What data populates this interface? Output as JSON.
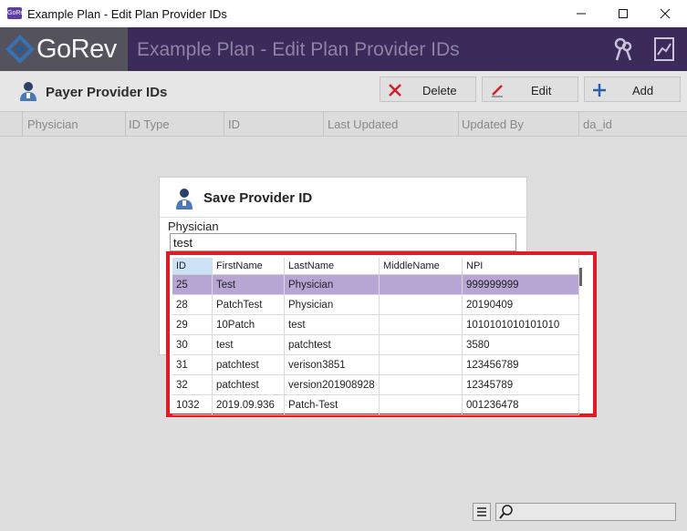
{
  "window": {
    "title": "Example Plan - Edit Plan Provider IDs",
    "icon_text": "GoRev"
  },
  "header": {
    "logo": "GoRev",
    "title": "Example Plan - Edit Plan Provider IDs"
  },
  "toolbar": {
    "section_title": "Payer Provider IDs",
    "delete_label": "Delete",
    "edit_label": "Edit",
    "add_label": "Add"
  },
  "grid": {
    "columns": [
      "Physician",
      "ID Type",
      "ID",
      "Last Updated",
      "Updated By",
      "da_id"
    ]
  },
  "dialog": {
    "title": "Save Provider ID",
    "physician_label": "Physician",
    "physician_value": "test"
  },
  "dropdown": {
    "columns": [
      "ID",
      "FirstName",
      "LastName",
      "MiddleName",
      "NPI"
    ],
    "rows": [
      [
        "25",
        "Test",
        "Physician",
        "",
        "999999999"
      ],
      [
        "28",
        "PatchTest",
        "Physician",
        "",
        "20190409"
      ],
      [
        "29",
        "10Patch",
        "test",
        "",
        "1010101010101010"
      ],
      [
        "30",
        "test",
        "patchtest",
        "",
        "3580"
      ],
      [
        "31",
        "patchtest",
        "verison3851",
        "",
        "123456789"
      ],
      [
        "32",
        "patchtest",
        "version201908928",
        "",
        "12345789"
      ],
      [
        "1032",
        "2019.09.936",
        "Patch-Test",
        "",
        "001236478"
      ]
    ],
    "highlighted_row": 0
  },
  "colors": {
    "brand_purple": "#3b2a5a",
    "highlight": "#b7a5d4",
    "annotation_red": "#e01b24"
  }
}
